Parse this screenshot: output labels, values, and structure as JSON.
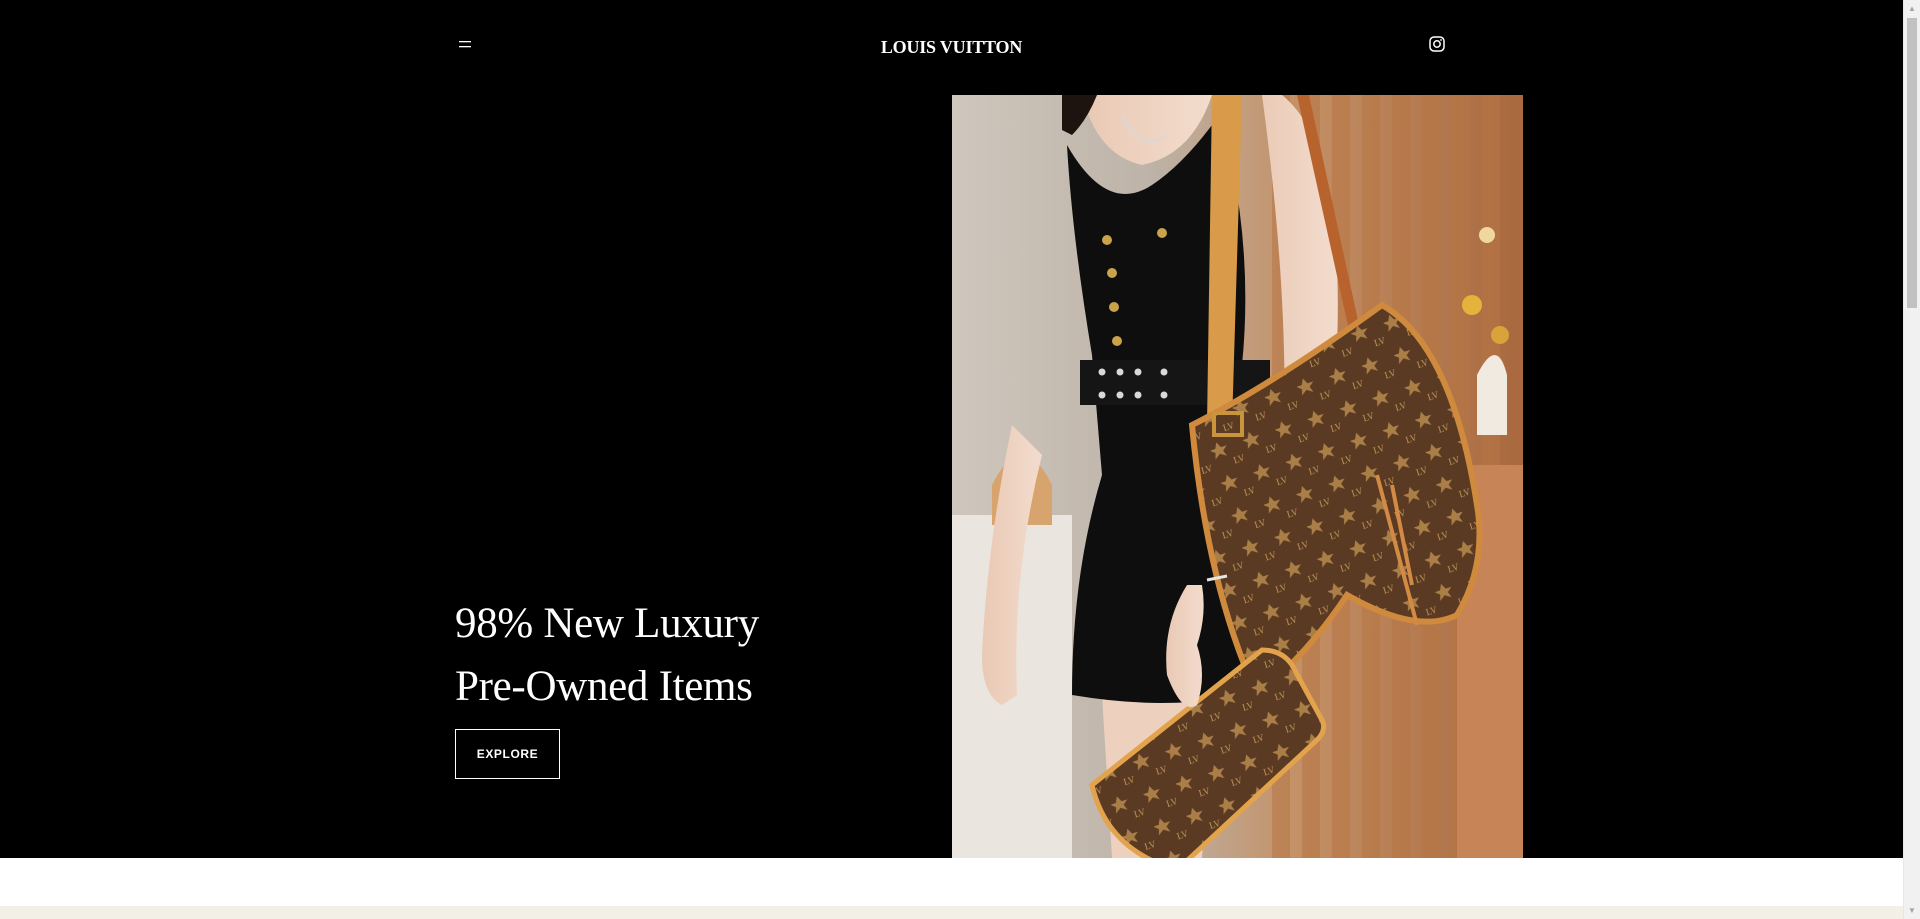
{
  "header": {
    "menu_icon": "hamburger-menu-icon",
    "brand": "LOUIS VUITTON",
    "social_icon": "instagram-icon"
  },
  "hero": {
    "line1": "98% New Luxury",
    "line2": "Pre-Owned Items",
    "cta_label": "EXPLORE",
    "image_subject": "woman in black dress carrying monogram tote bag and pouch"
  },
  "scrollbar": {
    "up_glyph": "▲",
    "down_glyph": "▼"
  },
  "colors": {
    "background": "#000000",
    "text": "#ffffff",
    "band_white": "#ffffff",
    "band_beige": "#f3eee6"
  }
}
